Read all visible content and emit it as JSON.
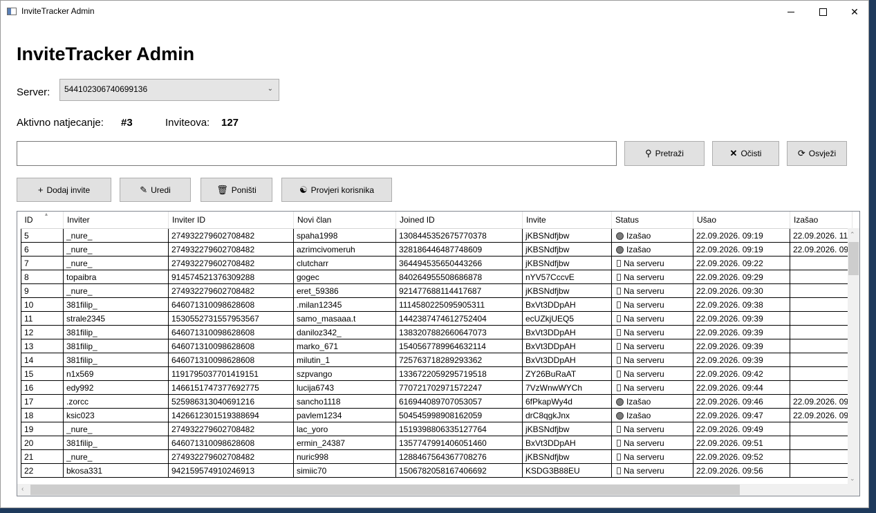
{
  "window": {
    "title": "InviteTracker Admin"
  },
  "header": {
    "title": "InviteTracker Admin"
  },
  "server": {
    "label": "Server:",
    "selected": "544102306740699136"
  },
  "stats": {
    "competition_label": "Aktivno natjecanje:",
    "competition_value": "#3",
    "invites_label": "Inviteova:",
    "invites_value": "127"
  },
  "search": {
    "value": "",
    "placeholder": ""
  },
  "toolbar": {
    "search_label": "Pretraži",
    "clear_label": "Očisti",
    "refresh_label": "Osvježi",
    "add_label": "Dodaj invite",
    "edit_label": "Uredi",
    "cancel_label": "Poništi",
    "check_label": "Provjeri korisnika"
  },
  "table": {
    "columns": [
      "ID",
      "Inviter",
      "Inviter ID",
      "Novi član",
      "Joined ID",
      "Invite",
      "Status",
      "Ušao",
      "Izašao"
    ],
    "rows": [
      [
        "5",
        "_nure_",
        "274932279602708482",
        "spaha1998",
        "1308445352675770378",
        "jKBSNdfjbw",
        "left",
        "Izašao",
        "22.09.2026. 09:19",
        "22.09.2026. 11"
      ],
      [
        "6",
        "_nure_",
        "274932279602708482",
        "azrimcivomeruh",
        "328186446487748609",
        "jKBSNdfjbw",
        "left",
        "Izašao",
        "22.09.2026. 09:19",
        "22.09.2026. 09"
      ],
      [
        "7",
        "_nure_",
        "274932279602708482",
        "clutcharr",
        "364494535650443266",
        "jKBSNdfjbw",
        "on",
        "Na serveru",
        "22.09.2026. 09:22",
        ""
      ],
      [
        "8",
        "topaibra",
        "914574521376309288",
        "gogec",
        "840264955508686878",
        "nYV57CccvE",
        "on",
        "Na serveru",
        "22.09.2026. 09:29",
        ""
      ],
      [
        "9",
        "_nure_",
        "274932279602708482",
        "eret_59386",
        "921477688114417687",
        "jKBSNdfjbw",
        "on",
        "Na serveru",
        "22.09.2026. 09:30",
        ""
      ],
      [
        "10",
        "381filip_",
        "646071310098628608",
        ".milan12345",
        "1114580225095905311",
        "BxVt3DDpAH",
        "on",
        "Na serveru",
        "22.09.2026. 09:38",
        ""
      ],
      [
        "11",
        "strale2345",
        "1530552731557953567",
        "samo_masaaa.t",
        "1442387474612752404",
        "ecUZkjUEQ5",
        "on",
        "Na serveru",
        "22.09.2026. 09:39",
        ""
      ],
      [
        "12",
        "381filip_",
        "646071310098628608",
        "daniloz342_",
        "1383207882660647073",
        "BxVt3DDpAH",
        "on",
        "Na serveru",
        "22.09.2026. 09:39",
        ""
      ],
      [
        "13",
        "381filip_",
        "646071310098628608",
        "marko_671",
        "1540567789964632114",
        "BxVt3DDpAH",
        "on",
        "Na serveru",
        "22.09.2026. 09:39",
        ""
      ],
      [
        "14",
        "381filip_",
        "646071310098628608",
        "milutin_1",
        "725763718289293362",
        "BxVt3DDpAH",
        "on",
        "Na serveru",
        "22.09.2026. 09:39",
        ""
      ],
      [
        "15",
        "n1x569",
        "1191795037701419151",
        "szpvango",
        "1336722059295719518",
        "ZY26BuRaAT",
        "on",
        "Na serveru",
        "22.09.2026. 09:42",
        ""
      ],
      [
        "16",
        "edy992",
        "1466151747377692775",
        "lucija6743",
        "770721702971572247",
        "7VzWnwWYCh",
        "on",
        "Na serveru",
        "22.09.2026. 09:44",
        ""
      ],
      [
        "17",
        ".zorcc",
        "525986313040691216",
        "sancho1118",
        "616944089707053057",
        "6fPkapWy4d",
        "left",
        "Izašao",
        "22.09.2026. 09:46",
        "22.09.2026. 09"
      ],
      [
        "18",
        "ksic023",
        "1426612301519388694",
        "pavlem1234",
        "504545998908162059",
        "drC8qgkJnx",
        "left",
        "Izašao",
        "22.09.2026. 09:47",
        "22.09.2026. 09"
      ],
      [
        "19",
        "_nure_",
        "274932279602708482",
        "lac_yoro",
        "1519398806335127764",
        "jKBSNdfjbw",
        "on",
        "Na serveru",
        "22.09.2026. 09:49",
        ""
      ],
      [
        "20",
        "381filip_",
        "646071310098628608",
        "ermin_24387",
        "1357747991406051460",
        "BxVt3DDpAH",
        "on",
        "Na serveru",
        "22.09.2026. 09:51",
        ""
      ],
      [
        "21",
        "_nure_",
        "274932279602708482",
        "nuric998",
        "1288467564367708276",
        "jKBSNdfjbw",
        "on",
        "Na serveru",
        "22.09.2026. 09:52",
        ""
      ],
      [
        "22",
        "bkosa331",
        "942159574910246913",
        "simiic70",
        "1506782058167406692",
        "KSDG3B88EU",
        "on",
        "Na serveru",
        "22.09.2026. 09:56",
        ""
      ]
    ]
  }
}
